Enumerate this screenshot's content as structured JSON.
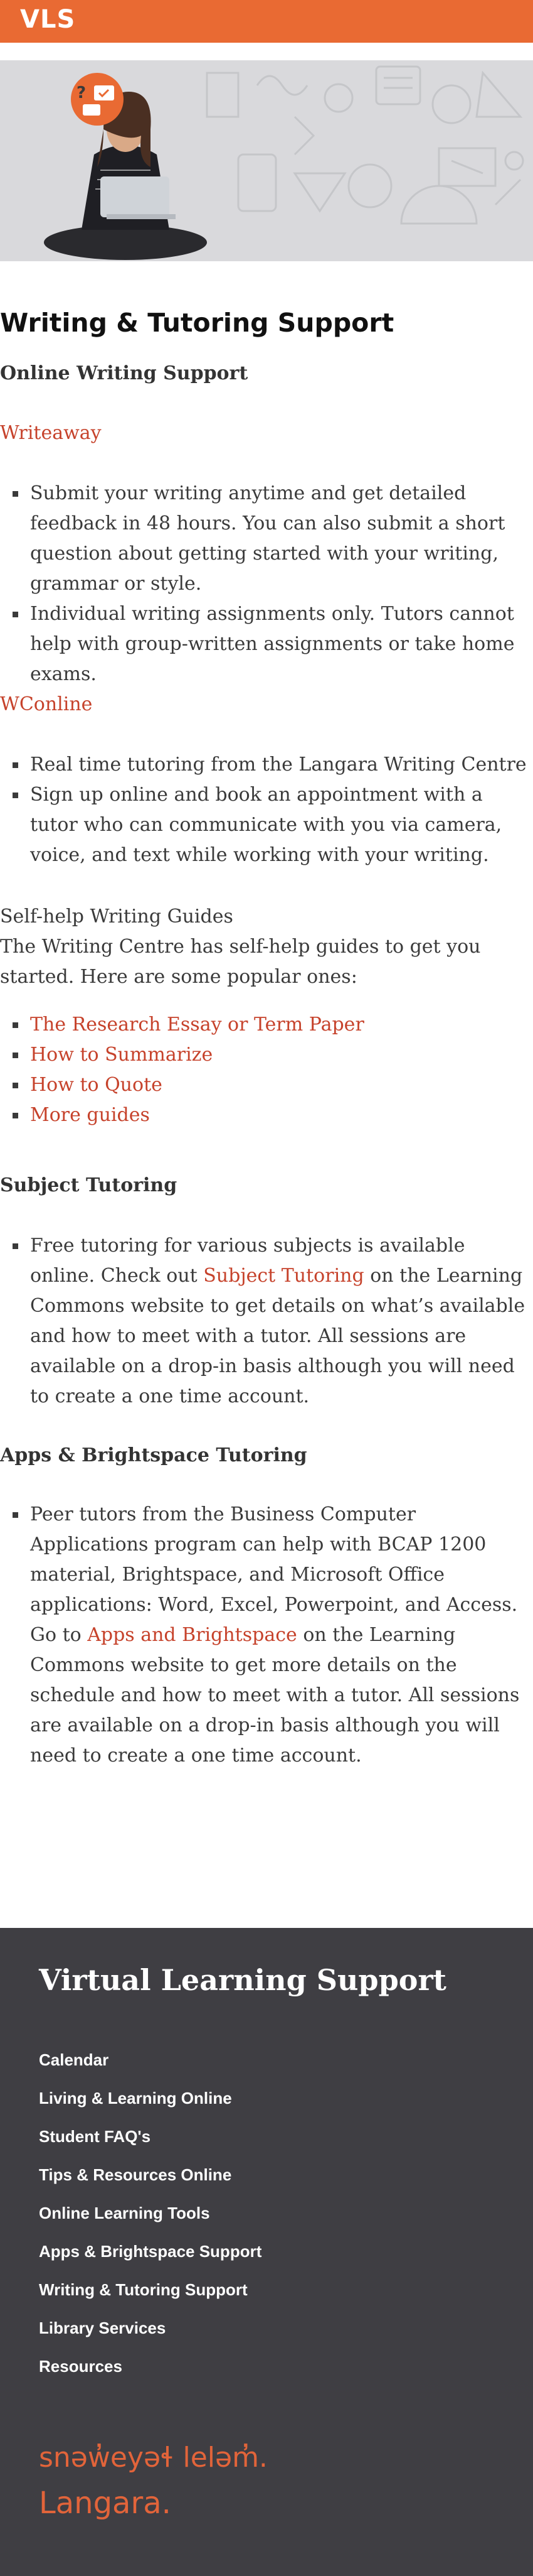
{
  "header": {
    "logo": "VLS",
    "brand_color": "#e96a33"
  },
  "hero": {
    "illustration": "student-with-laptop-illustration",
    "badge_icon": "question-chat-icon"
  },
  "page": {
    "title": "Writing & Tutoring Support",
    "online_writing": {
      "heading": "Online Writing Support",
      "writeaway": {
        "link": "Writeaway",
        "items": [
          "Submit your writing anytime and get detailed feedback in 48 hours.  You can also submit a short question about getting started with your writing, grammar or style.",
          "Individual writing assignments only.  Tutors cannot help with group-written assignments or take home exams."
        ]
      },
      "wconline": {
        "link": "WConline",
        "items": [
          "Real time tutoring from the Langara Writing Centre",
          "Sign up online and book an appointment with a tutor who can communicate with you via camera, voice, and text while working with your writing."
        ]
      },
      "self_help": {
        "label": "Self-help Writing Guides",
        "intro": "The Writing Centre has self-help guides to get you started. Here are some popular ones:",
        "guides": [
          "The Research Essay or Term Paper",
          "How to Summarize",
          "How to Quote",
          "More guides"
        ]
      }
    },
    "subject_tutoring": {
      "heading": "Subject Tutoring",
      "text_before": "Free tutoring for various subjects is available online.  Check out ",
      "link": "Subject Tutoring",
      "text_after": " on the Learning Commons website to get details on what’s available and how to meet with a tutor.  All sessions are available on a drop-in basis although you will need to create a one time account."
    },
    "apps_tutoring": {
      "heading": "Apps & Brightspace Tutoring",
      "text_before": "Peer tutors from the Business Computer Applications program can help with BCAP 1200 material, Brightspace, and Microsoft Office applications: Word, Excel, Powerpoint, and Access. Go to ",
      "link": "Apps and Brightspace",
      "text_after": " on the Learning Commons website to get more details on the schedule and how to meet with a tutor. All sessions are available on a drop-in basis although you will need to create a one time account."
    }
  },
  "footer": {
    "title": "Virtual Learning Support",
    "nav": [
      "Calendar",
      "Living & Learning Online",
      "Student FAQ's",
      "Tips & Resources Online",
      "Online Learning Tools",
      "Apps & Brightspace Support",
      "Writing & Tutoring Support",
      "Library Services",
      "Resources"
    ],
    "brand_line_1": "snəw̓eyəɬ leləm̓.",
    "brand_line_2": "Langara.",
    "bg_color": "#3f3e43",
    "accent_color": "#e2643a"
  }
}
